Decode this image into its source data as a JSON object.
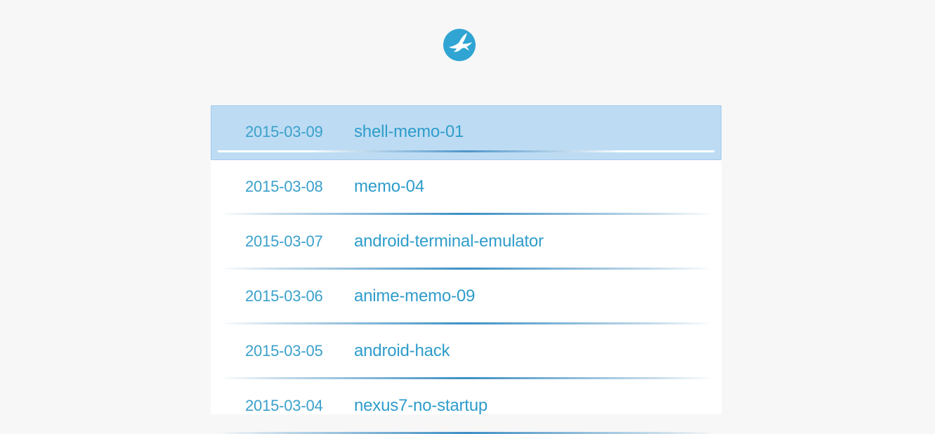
{
  "header": {
    "logo_icon": "bird-circle-icon",
    "accent_color": "#30a5d3"
  },
  "posts": [
    {
      "date": "2015-03-09",
      "title": "shell-memo-01",
      "selected": true
    },
    {
      "date": "2015-03-08",
      "title": "memo-04",
      "selected": false
    },
    {
      "date": "2015-03-07",
      "title": "android-terminal-emulator",
      "selected": false
    },
    {
      "date": "2015-03-06",
      "title": "anime-memo-09",
      "selected": false
    },
    {
      "date": "2015-03-05",
      "title": "android-hack",
      "selected": false
    },
    {
      "date": "2015-03-04",
      "title": "nexus7-no-startup",
      "selected": false
    }
  ]
}
